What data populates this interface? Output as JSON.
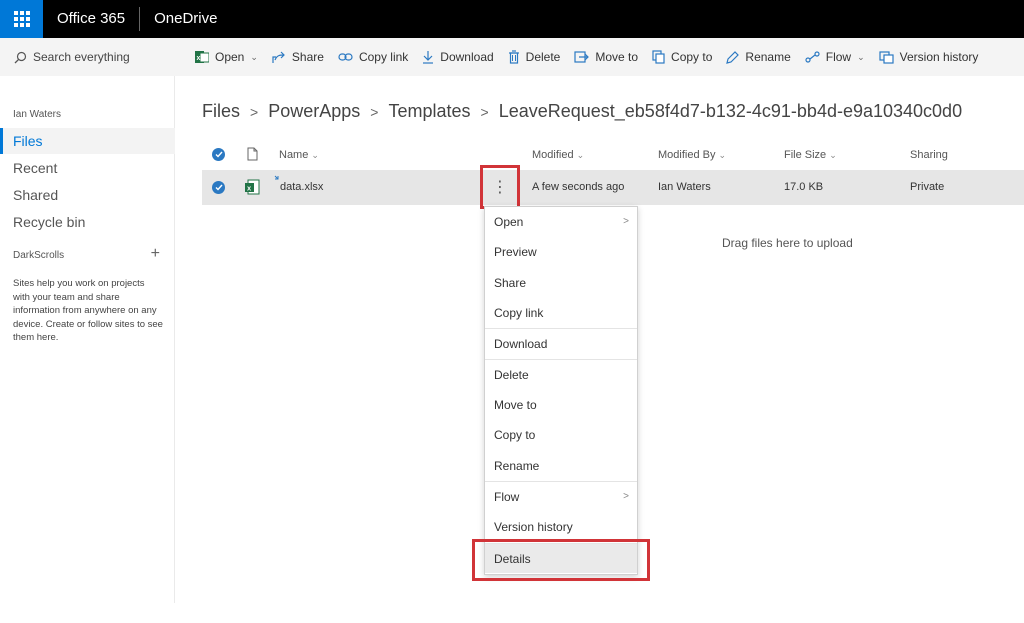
{
  "topbar": {
    "suite": "Office 365",
    "app": "OneDrive"
  },
  "search": {
    "placeholder": "Search everything"
  },
  "nav": {
    "user": "Ian Waters",
    "items": [
      {
        "label": "Files",
        "active": true
      },
      {
        "label": "Recent",
        "active": false
      },
      {
        "label": "Shared",
        "active": false
      },
      {
        "label": "Recycle bin",
        "active": false
      }
    ],
    "sites_heading": "DarkScrolls",
    "sites_note": "Sites help you work on projects with your team and share information from anywhere on any device. Create or follow sites to see them here."
  },
  "toolbar": {
    "open": "Open",
    "share": "Share",
    "copy_link": "Copy link",
    "download": "Download",
    "delete": "Delete",
    "move_to": "Move to",
    "copy_to": "Copy to",
    "rename": "Rename",
    "flow": "Flow",
    "version_history": "Version history"
  },
  "breadcrumb": [
    "Files",
    "PowerApps",
    "Templates",
    "LeaveRequest_eb58f4d7-b132-4c91-bb4d-e9a10340c0d0"
  ],
  "list": {
    "columns": {
      "name": "Name",
      "modified": "Modified",
      "modified_by": "Modified By",
      "file_size": "File Size",
      "sharing": "Sharing"
    },
    "rows": [
      {
        "name": "data.xlsx",
        "modified": "A few seconds ago",
        "modified_by": "Ian Waters",
        "file_size": "17.0 KB",
        "sharing": "Private"
      }
    ],
    "drop_hint": "Drag files here to upload"
  },
  "context_menu": {
    "items": [
      {
        "label": "Open",
        "submenu": true
      },
      {
        "label": "Preview"
      },
      {
        "label": "Share"
      },
      {
        "label": "Copy link"
      },
      {
        "label": "Download"
      },
      {
        "label": "Delete"
      },
      {
        "label": "Move to"
      },
      {
        "label": "Copy to"
      },
      {
        "label": "Rename"
      },
      {
        "label": "Flow",
        "submenu": true
      },
      {
        "label": "Version history"
      },
      {
        "label": "Details"
      }
    ]
  },
  "colors": {
    "accent": "#0078d7",
    "highlight": "#d13438",
    "excel": "#217346"
  }
}
